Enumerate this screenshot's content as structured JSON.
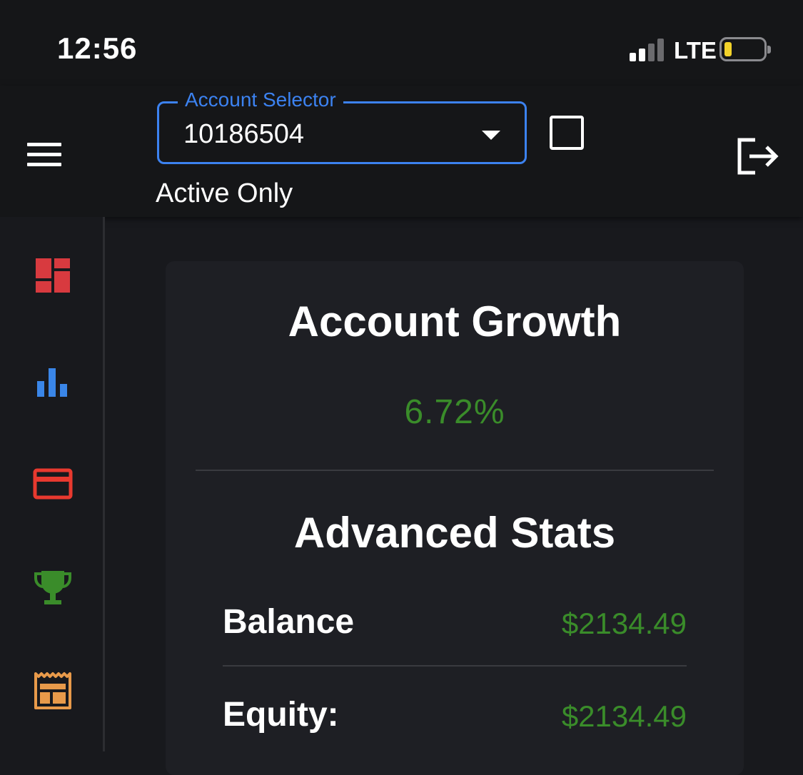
{
  "status_bar": {
    "time": "12:56",
    "carrier": "LTE",
    "battery_level": 0.18
  },
  "app_bar": {
    "menu_icon": "hamburger-menu-icon",
    "account_selector": {
      "label": "Account Selector",
      "value": "10186504"
    },
    "active_only_label": "Active Only",
    "active_only_checked": false,
    "logout_icon": "logout-icon"
  },
  "sidebar": {
    "items": [
      {
        "icon": "dashboard-icon",
        "color": "#d83a3f"
      },
      {
        "icon": "bar-chart-icon",
        "color": "#3a86e8"
      },
      {
        "icon": "credit-card-icon",
        "color": "#e8392f"
      },
      {
        "icon": "trophy-icon",
        "color": "#3a8c2a"
      },
      {
        "icon": "calendar-table-icon",
        "color": "#e89a4a"
      }
    ]
  },
  "main": {
    "growth_title": "Account Growth",
    "growth_value": "6.72%",
    "stats_title": "Advanced Stats",
    "stats": [
      {
        "label": "Balance",
        "value": "$2134.49"
      },
      {
        "label": "Equity:",
        "value": "$2134.49"
      }
    ]
  },
  "colors": {
    "accent": "#3c82f0",
    "positive": "#3a8c2a",
    "background": "#18191d",
    "card": "#1e1f24"
  }
}
